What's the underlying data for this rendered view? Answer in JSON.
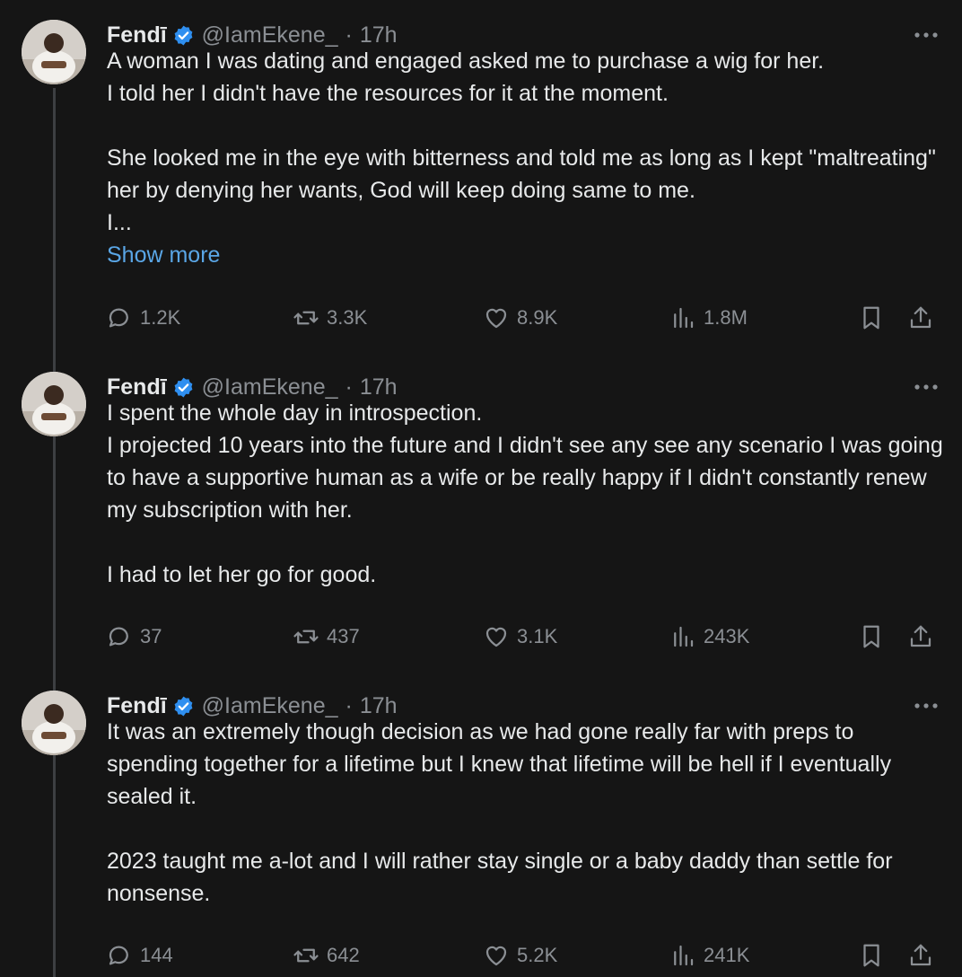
{
  "tweets": [
    {
      "author_name": "Fendī",
      "handle": "@IamEkene_",
      "separator": "·",
      "time": "17h",
      "text": "A woman I was dating and engaged asked me to purchase a wig for her.\nI told her I didn't have the resources for it at the moment.\n\nShe looked me in the eye with bitterness and told me as long as I kept \"maltreating\" her by denying her wants, God will keep doing same to me.\nI...",
      "show_more": "Show more",
      "replies": "1.2K",
      "retweets": "3.3K",
      "likes": "8.9K",
      "views": "1.8M"
    },
    {
      "author_name": "Fendī",
      "handle": "@IamEkene_",
      "separator": "·",
      "time": "17h",
      "text": "I spent the whole day in introspection.\nI projected 10 years into the future and I didn't see any see any scenario I was going to have a supportive human as a wife or be really happy if I didn't constantly renew my subscription with her.\n\nI had to let her go for good.",
      "replies": "37",
      "retweets": "437",
      "likes": "3.1K",
      "views": "243K"
    },
    {
      "author_name": "Fendī",
      "handle": "@IamEkene_",
      "separator": "·",
      "time": "17h",
      "text": "It was an extremely though decision as we had gone really far with preps to spending together for a lifetime but I knew that lifetime will be hell if I eventually sealed it.\n\n2023 taught me a-lot and I will rather stay single or a baby daddy than settle for nonsense.",
      "replies": "144",
      "retweets": "642",
      "likes": "5.2K",
      "views": "241K"
    }
  ],
  "icons": {
    "verified": "verified-badge-icon",
    "more": "more-options-icon",
    "reply": "reply-icon",
    "retweet": "retweet-icon",
    "like": "heart-icon",
    "views": "views-icon",
    "bookmark": "bookmark-icon",
    "share": "share-icon"
  },
  "colors": {
    "background": "#151515",
    "text": "#e7e9ea",
    "muted": "#8b8f94",
    "link": "#5aa6e6",
    "verified": "#2f8ff0",
    "thread_line": "#3d3f42"
  }
}
